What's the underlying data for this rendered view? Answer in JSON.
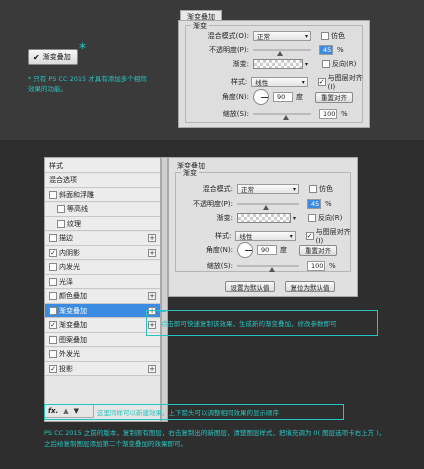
{
  "top": {
    "button_label": "渐变叠加",
    "note": "* 只有 PS CC 2015 才具有添加多个相同效果的功能。",
    "panel_title": "渐变叠加",
    "group_title": "渐变",
    "blend_label": "混合模式(O):",
    "blend_value": "正常",
    "dither_label": "仿色",
    "opacity_label": "不透明度(P):",
    "opacity_value": "45",
    "gradient_label": "渐变:",
    "reverse_label": "反向(R)",
    "style_label": "样式:",
    "style_value": "线性",
    "align_label": "与图层对齐(I)",
    "angle_label": "角度(N):",
    "angle_value": "90",
    "degree": "度",
    "reset_align": "重置对齐",
    "scale_label": "缩放(S):",
    "scale_value": "100",
    "percent": "%"
  },
  "list": {
    "items": [
      {
        "label": "样式",
        "check": false,
        "plus": false,
        "indent": false
      },
      {
        "label": "混合选项",
        "check": false,
        "plus": false,
        "indent": false
      },
      {
        "label": "斜面和浮雕",
        "check": true,
        "checked": false,
        "plus": false,
        "indent": false
      },
      {
        "label": "等高线",
        "check": true,
        "checked": false,
        "plus": false,
        "indent": true
      },
      {
        "label": "纹理",
        "check": true,
        "checked": false,
        "plus": false,
        "indent": true
      },
      {
        "label": "描边",
        "check": true,
        "checked": false,
        "plus": true,
        "indent": false
      },
      {
        "label": "内阴影",
        "check": true,
        "checked": true,
        "plus": true,
        "indent": false
      },
      {
        "label": "内发光",
        "check": true,
        "checked": false,
        "plus": false,
        "indent": false
      },
      {
        "label": "光泽",
        "check": true,
        "checked": false,
        "plus": false,
        "indent": false
      },
      {
        "label": "颜色叠加",
        "check": true,
        "checked": false,
        "plus": true,
        "indent": false
      },
      {
        "label": "渐变叠加",
        "check": true,
        "checked": true,
        "plus": true,
        "indent": false,
        "selected": true
      },
      {
        "label": "渐变叠加",
        "check": true,
        "checked": true,
        "plus": true,
        "indent": false
      },
      {
        "label": "图案叠加",
        "check": true,
        "checked": false,
        "plus": false,
        "indent": false
      },
      {
        "label": "外发光",
        "check": true,
        "checked": false,
        "plus": false,
        "indent": false
      },
      {
        "label": "投影",
        "check": true,
        "checked": true,
        "plus": true,
        "indent": false
      }
    ],
    "fx": "fx.",
    "up": "▲",
    "down": "▼"
  },
  "panel2": {
    "title": "渐变叠加",
    "group_title": "渐变",
    "blend_label": "混合模式:",
    "blend_value": "正常",
    "dither_label": "仿色",
    "opacity_label": "不透明度(P):",
    "opacity_value": "45",
    "gradient_label": "渐变:",
    "reverse_label": "反向(R)",
    "style_label": "样式:",
    "style_value": "线性",
    "align_label": "与图层对齐(I)",
    "angle_label": "角度(N):",
    "angle_value": "90",
    "degree": "度",
    "reset_align": "重置对齐",
    "scale_label": "缩放(S):",
    "scale_value": "100",
    "percent": "%",
    "set_default": "设置为默认值",
    "reset_default": "复位为默认值"
  },
  "callouts": {
    "plus_note": "点击即可快速复制该效果，生成新的渐变叠加，修改参数即可",
    "bar_note": "这里同样可以新建效果，上下箭头可以调整相同效果的显示顺序"
  },
  "bottom_note": "PS CC 2015 之前的版本，复制原有图层，右击复制出的新图层，清楚图层样式，把填充调为 0( 图层选项卡右上方 )，之后给复制图层添加第二个渐变叠加的效果即可。",
  "colors": {
    "accent": "#29c4c0",
    "selected": "#3b8be3"
  }
}
